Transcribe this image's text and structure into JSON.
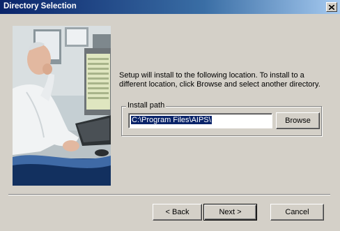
{
  "window": {
    "title": "Directory Selection",
    "close_icon": "close-icon"
  },
  "main": {
    "description": "Setup will install to the following location.  To install to a different location, click Browse and select another directory.",
    "install_path": {
      "group_label": "Install path",
      "value": "C:\\Program Files\\AIPS\\",
      "browse_label": "Browse"
    }
  },
  "footer": {
    "back_label": "< Back",
    "next_label": "Next >",
    "cancel_label": "Cancel"
  },
  "colors": {
    "title_bar": "#0a246a",
    "dialog_bg": "#d4d0c8",
    "selection": "#0a246a"
  }
}
